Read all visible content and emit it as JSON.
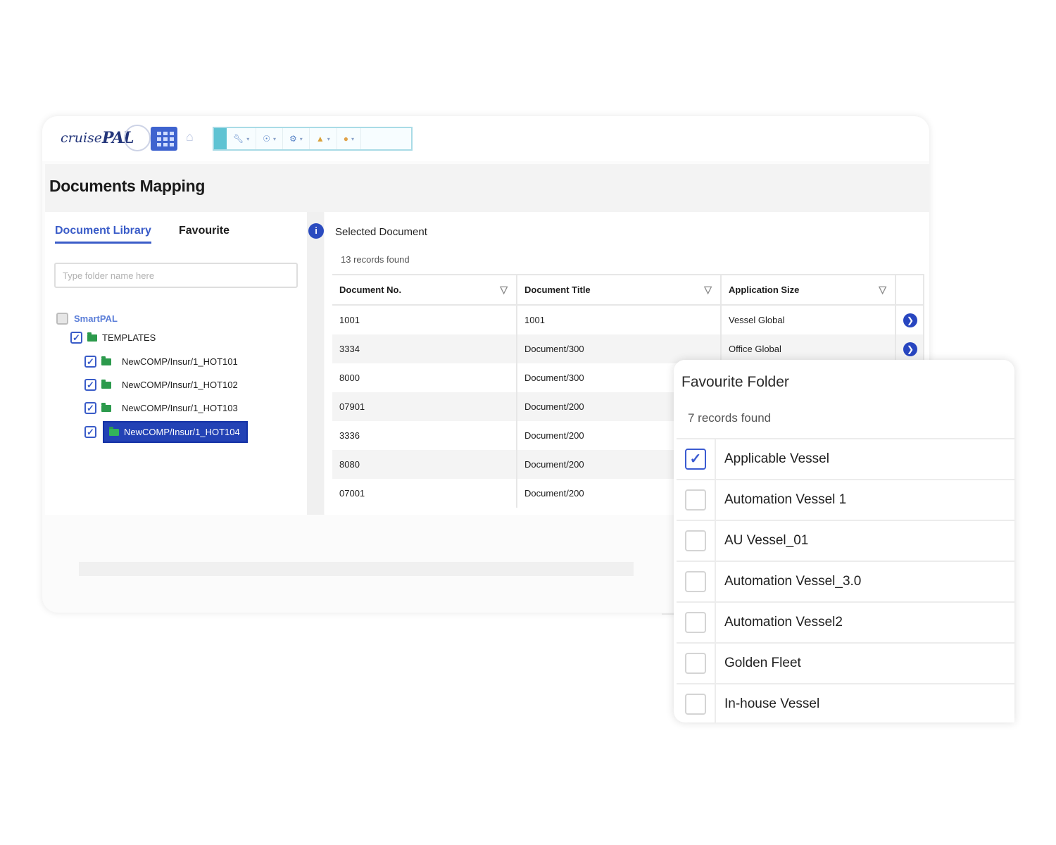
{
  "app": {
    "logo_text_1": "cruise",
    "logo_text_2": "PAL",
    "page_title": "Documents Mapping"
  },
  "toolbar": {
    "icons": [
      "apps-grid-icon",
      "home-icon",
      "wrench-icon",
      "bulb-icon",
      "gear-icon",
      "ship-icon",
      "coin-icon"
    ]
  },
  "left": {
    "tabs": [
      "Document Library",
      "Favourite"
    ],
    "search_placeholder": "Type folder name here",
    "tree": {
      "root": "SmartPAL",
      "templates": "TEMPLATES",
      "leaves": [
        "NewCOMP/Insur/1_HOT101",
        "NewCOMP/Insur/1_HOT102",
        "NewCOMP/Insur/1_HOT103",
        "NewCOMP/Insur/1_HOT104"
      ],
      "selected_index": 3
    }
  },
  "right": {
    "title": "Selected Document",
    "records": "13 records found",
    "columns": [
      "Document No.",
      "Document Title",
      "Application Size"
    ],
    "rows": [
      [
        "1001",
        "1001",
        "Vessel Global"
      ],
      [
        "3334",
        "Document/300",
        "Office Global"
      ],
      [
        "8000",
        "Document/300",
        ""
      ],
      [
        "07901",
        "Document/200",
        ""
      ],
      [
        "3336",
        "Document/200",
        ""
      ],
      [
        "8080",
        "Document/200",
        ""
      ],
      [
        "07001",
        "Document/200",
        ""
      ]
    ]
  },
  "favourite_folder": {
    "title": "Favourite Folder",
    "records": "7 records found",
    "items": [
      {
        "label": "Applicable Vessel",
        "checked": true
      },
      {
        "label": "Automation Vessel 1",
        "checked": false
      },
      {
        "label": "AU Vessel_01",
        "checked": false
      },
      {
        "label": "Automation Vessel_3.0",
        "checked": false
      },
      {
        "label": "Automation Vessel2",
        "checked": false
      },
      {
        "label": "Golden Fleet",
        "checked": false
      },
      {
        "label": "In-house Vessel",
        "checked": false
      }
    ]
  },
  "colors": {
    "accent": "#3a5cc8",
    "selected_bg": "#2342b5",
    "folder_green": "#2c9a4c",
    "toolbar_border": "#a9dbe6"
  }
}
